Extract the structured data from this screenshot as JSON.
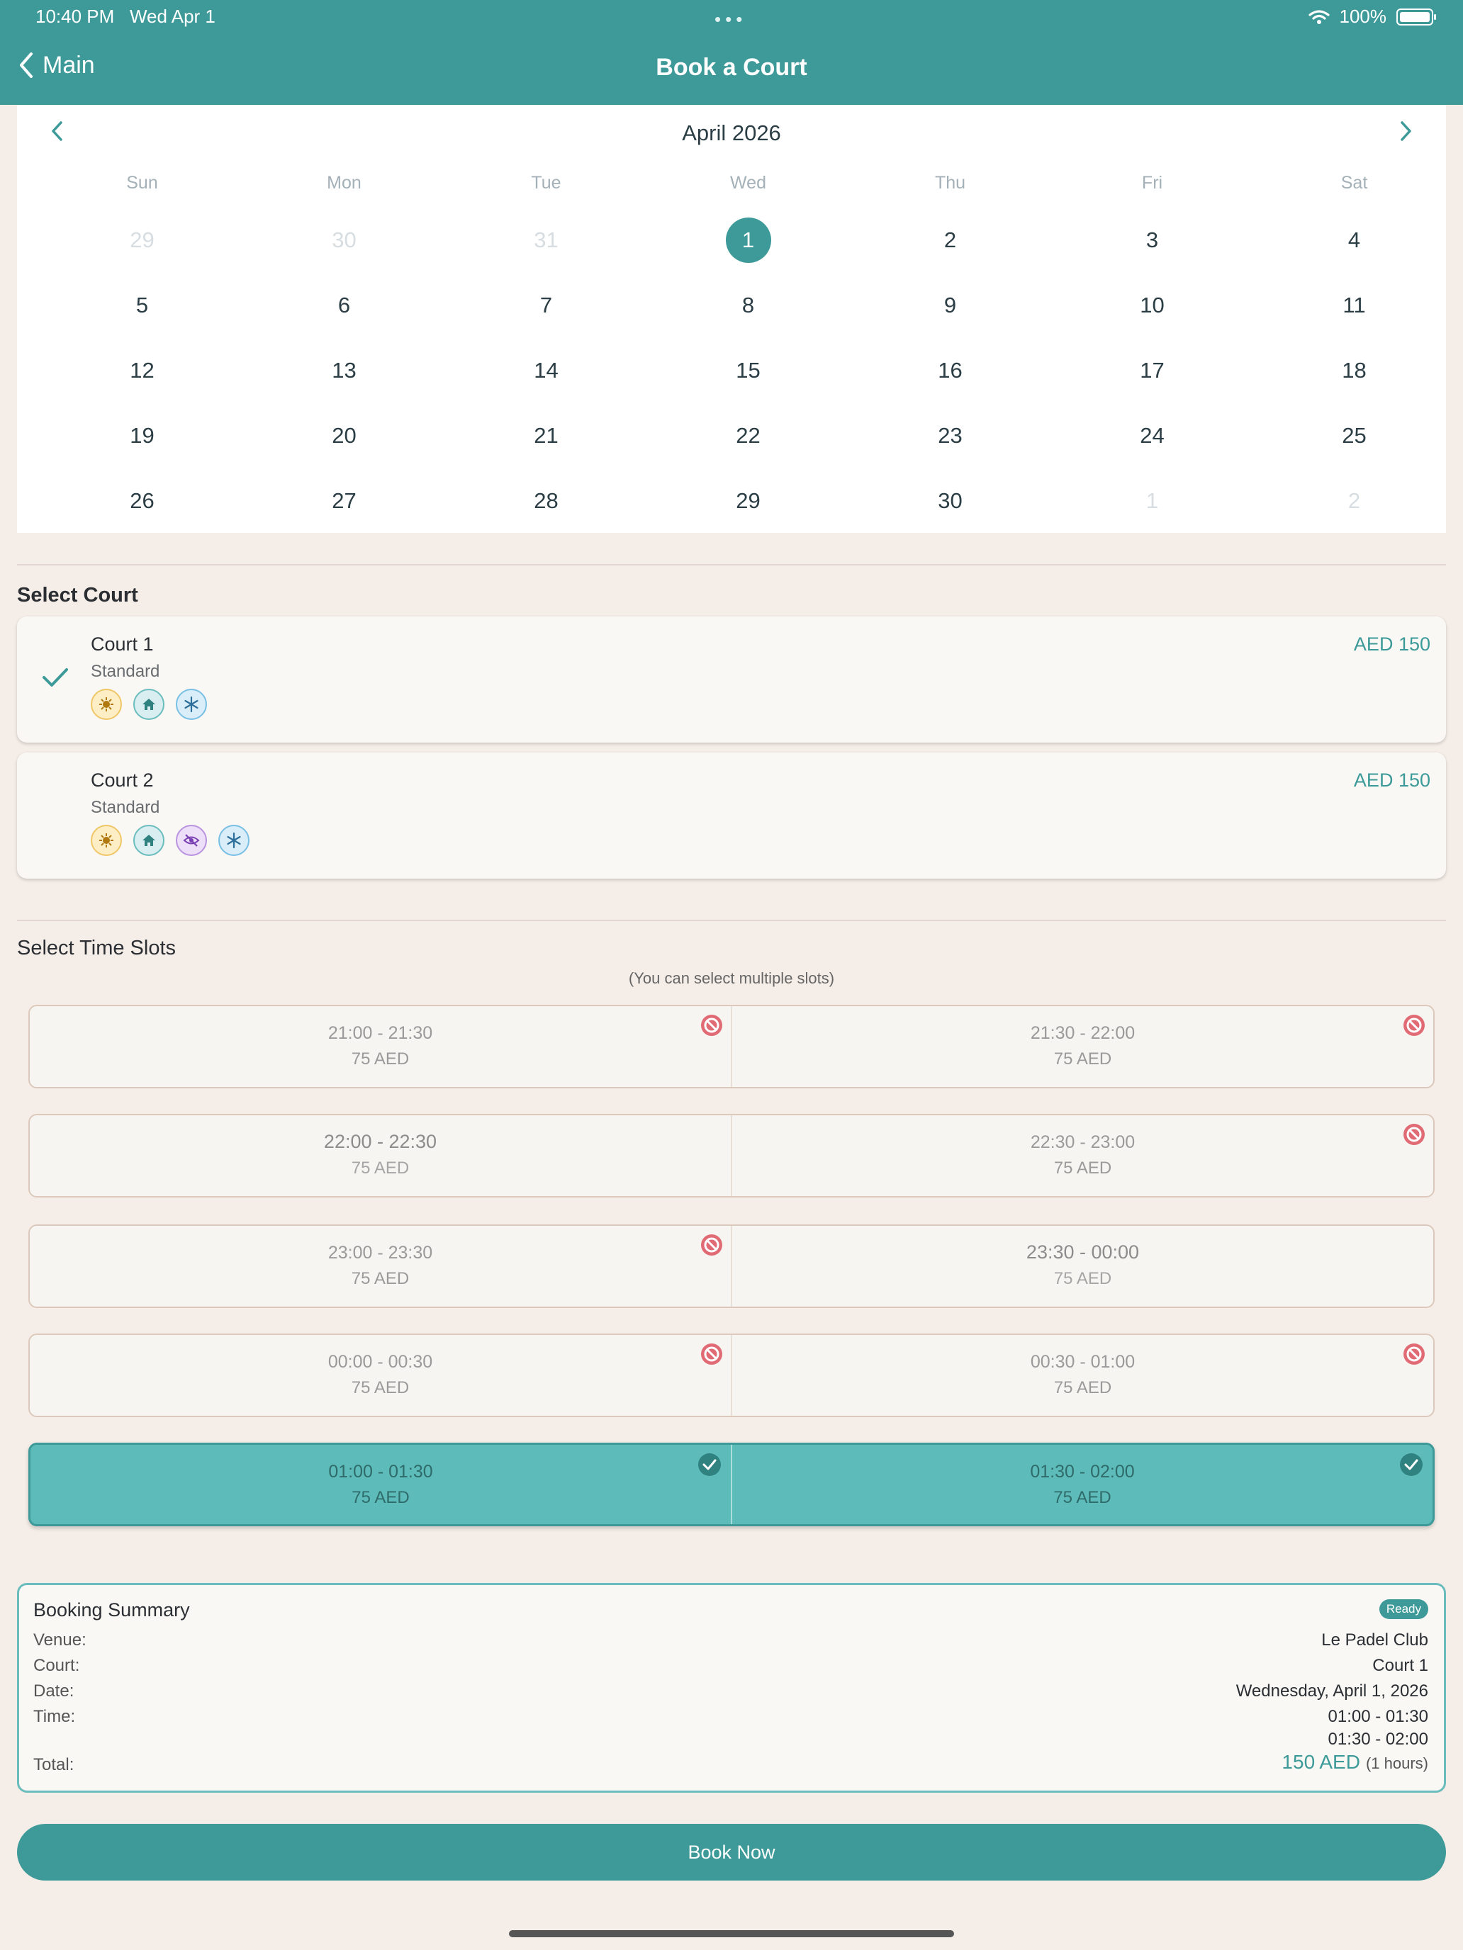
{
  "status_bar": {
    "time": "10:40 PM",
    "date": "Wed Apr 1",
    "battery": "100%"
  },
  "nav": {
    "back_label": "Main",
    "title": "Book a Court"
  },
  "calendar": {
    "month": "April 2026",
    "weekdays": [
      "Sun",
      "Mon",
      "Tue",
      "Wed",
      "Thu",
      "Fri",
      "Sat"
    ],
    "weeks": [
      [
        "29",
        "30",
        "31",
        "1",
        "2",
        "3",
        "4"
      ],
      [
        "5",
        "6",
        "7",
        "8",
        "9",
        "10",
        "11"
      ],
      [
        "12",
        "13",
        "14",
        "15",
        "16",
        "17",
        "18"
      ],
      [
        "19",
        "20",
        "21",
        "22",
        "23",
        "24",
        "25"
      ],
      [
        "26",
        "27",
        "28",
        "29",
        "30",
        "1",
        "2"
      ]
    ],
    "selected": "1"
  },
  "courts": {
    "title": "Select Court",
    "items": [
      {
        "name": "Court 1",
        "type": "Standard",
        "price": "AED 150",
        "selected": true,
        "amenities": [
          "light-icon",
          "indoor-home-icon",
          "air-conditioning-snowflake-icon"
        ]
      },
      {
        "name": "Court 2",
        "type": "Standard",
        "price": "AED 150",
        "selected": false,
        "amenities": [
          "light-icon",
          "indoor-home-icon",
          "hidden-eye-slash-icon",
          "air-conditioning-snowflake-icon"
        ]
      }
    ]
  },
  "slots": {
    "title": "Select Time Slots",
    "hint": "(You can select multiple slots)",
    "rows": [
      [
        {
          "time": "21:00 - 21:30",
          "price": "75 AED",
          "state": "unavailable"
        },
        {
          "time": "21:30 - 22:00",
          "price": "75 AED",
          "state": "unavailable"
        }
      ],
      [
        {
          "time": "22:00 - 22:30",
          "price": "75 AED",
          "state": "available"
        },
        {
          "time": "22:30 - 23:00",
          "price": "75 AED",
          "state": "unavailable"
        }
      ],
      [
        {
          "time": "23:00 - 23:30",
          "price": "75 AED",
          "state": "unavailable"
        },
        {
          "time": "23:30 - 00:00",
          "price": "75 AED",
          "state": "available"
        }
      ],
      [
        {
          "time": "00:00 - 00:30",
          "price": "75 AED",
          "state": "unavailable"
        },
        {
          "time": "00:30 - 01:00",
          "price": "75 AED",
          "state": "unavailable"
        }
      ],
      [
        {
          "time": "01:00 - 01:30",
          "price": "75 AED",
          "state": "selected"
        },
        {
          "time": "01:30 - 02:00",
          "price": "75 AED",
          "state": "selected"
        }
      ]
    ]
  },
  "summary": {
    "title": "Booking Summary",
    "badge": "Ready",
    "venue_label": "Venue:",
    "venue": "Le Padel Club",
    "court_label": "Court:",
    "court": "Court 1",
    "date_label": "Date:",
    "date": "Wednesday, April 1, 2026",
    "time_label": "Time:",
    "times": [
      "01:00 - 01:30",
      "01:30 - 02:00"
    ],
    "total_label": "Total:",
    "total": "150 AED",
    "hours": "(1 hours)"
  },
  "book_button": "Book Now",
  "colors": {
    "accent": "#3d9a99",
    "selected_slot": "#5dbcba",
    "unavailable": "#e06b74",
    "background": "#f5ede7"
  }
}
